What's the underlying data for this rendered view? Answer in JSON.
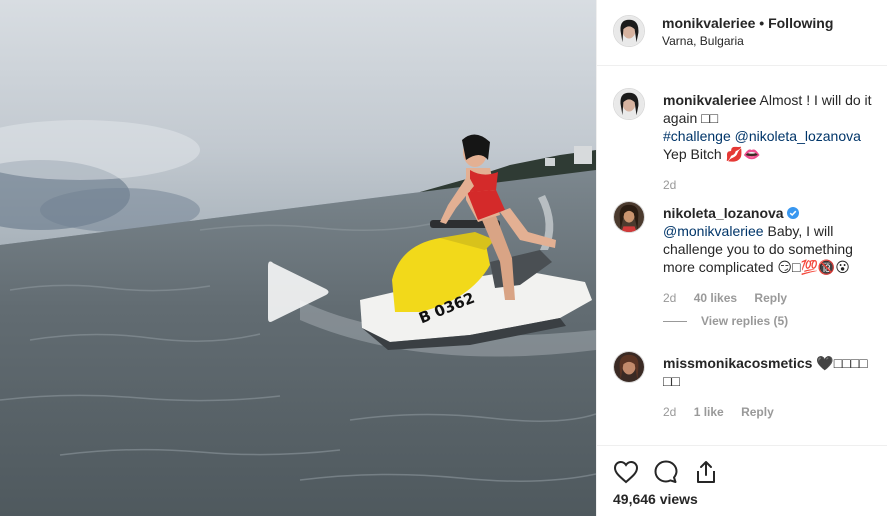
{
  "post": {
    "username": "monikvaleriee",
    "separator": "•",
    "follow_status": "Following",
    "location": "Varna, Bulgaria"
  },
  "caption": {
    "username": "monikvaleriee",
    "text": "Almost ! I will do it again",
    "emoji_boxes": "□□",
    "hashtag": "#challenge",
    "mention": "@nikoleta_lozanova",
    "text_end": "Yep Bitch",
    "emoji_end": "💋👄",
    "time": "2d"
  },
  "comments": [
    {
      "username": "nikoleta_lozanova",
      "mention": "@monikvaleriee",
      "text": "Baby, I will challenge you to do something more complicated",
      "emoji": "😏□💯🔞😮",
      "time": "2d",
      "likes": "40 likes",
      "reply": "Reply",
      "view_replies": "View replies (5)"
    },
    {
      "username": "missmonikacosmetics",
      "text": "🖤□□□□",
      "emoji_line2": "□□",
      "time": "2d",
      "likes": "1 like",
      "reply": "Reply"
    }
  ],
  "stats": {
    "views": "49,646 views"
  },
  "jetski_label": "B 0362",
  "colors": {
    "link": "#003569",
    "muted": "#999999",
    "text": "#262626",
    "verified": "#3897f0"
  },
  "icons": [
    "play-icon",
    "heart-icon",
    "comment-icon",
    "share-icon",
    "verified-icon"
  ]
}
